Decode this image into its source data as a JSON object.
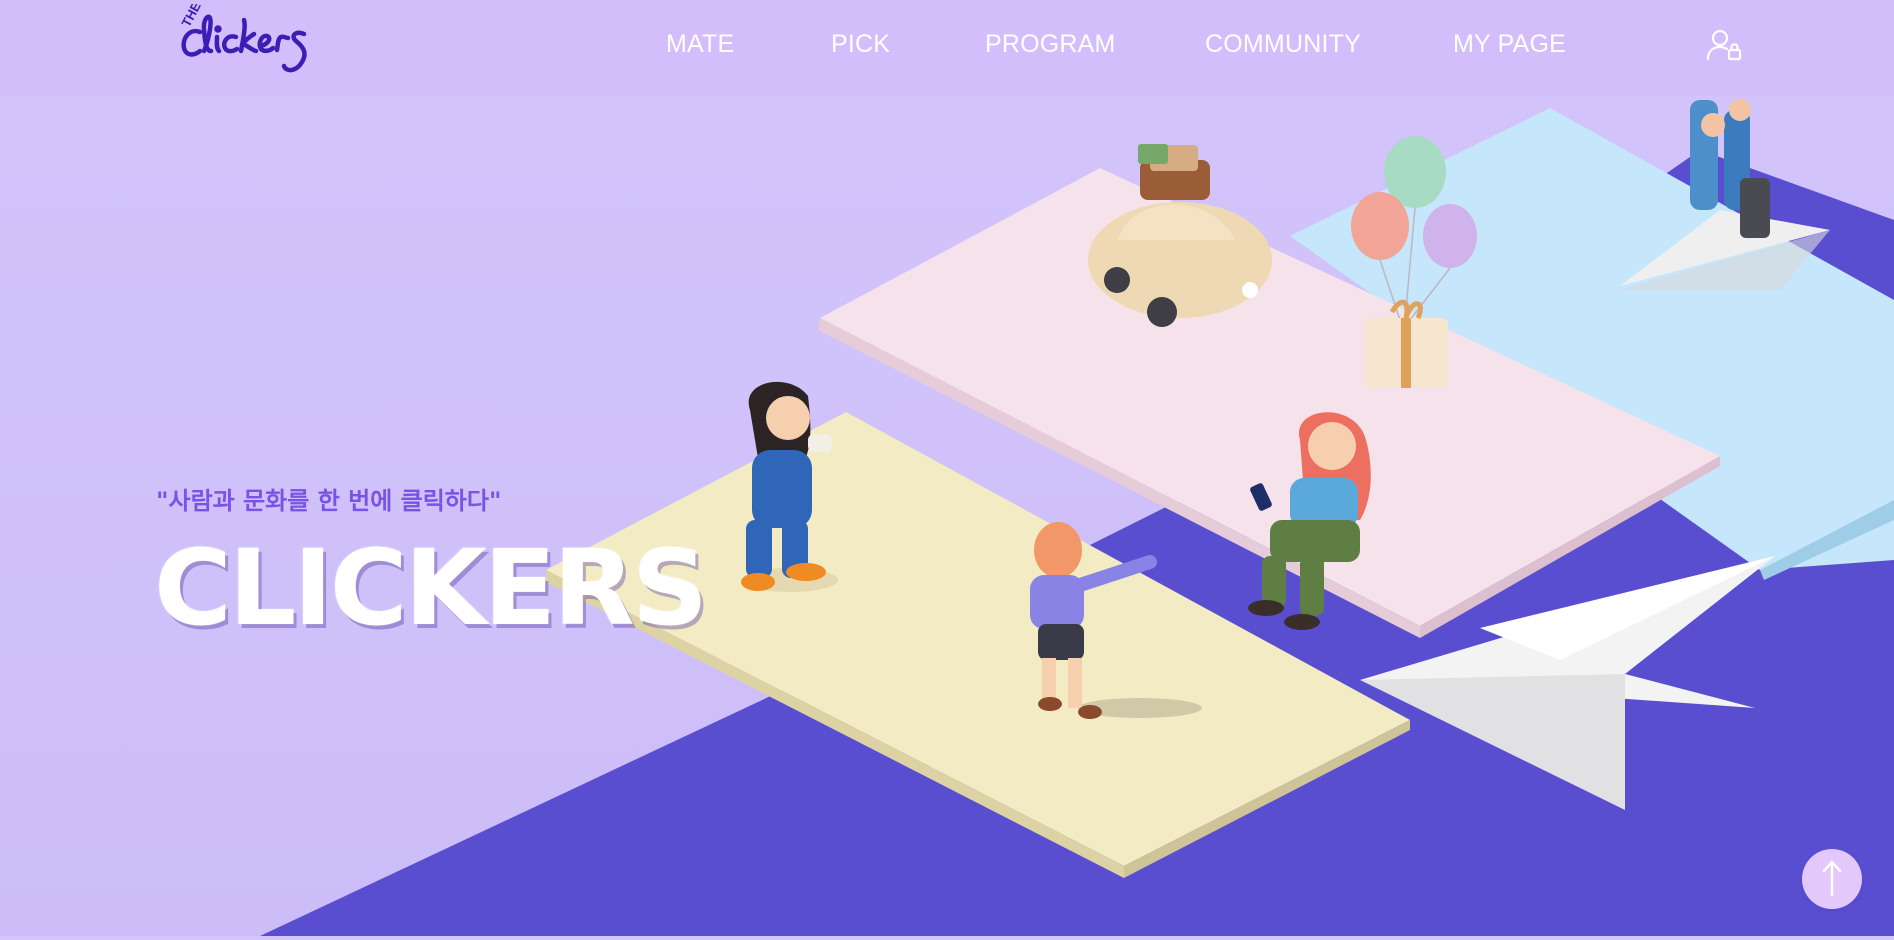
{
  "header": {
    "logo_alt": "THE clickers",
    "logo_small": "THE",
    "logo_word": "clickers",
    "nav": [
      {
        "label": "MATE"
      },
      {
        "label": "PICK"
      },
      {
        "label": "PROGRAM"
      },
      {
        "label": "COMMUNITY"
      },
      {
        "label": "MY PAGE"
      }
    ],
    "user_icon": "user-lock-icon"
  },
  "hero": {
    "tagline": "\"사람과 문화를 한 번에 클릭하다\"",
    "brand": "CLICKERS"
  },
  "scroll_top": {
    "icon": "arrow-up-icon"
  },
  "colors": {
    "header_bg": "#d4bdfb",
    "background": "#d3c5fb",
    "floor": "#5b4fd0",
    "tagline": "#7a52e6",
    "logo": "#3b1fb5"
  }
}
